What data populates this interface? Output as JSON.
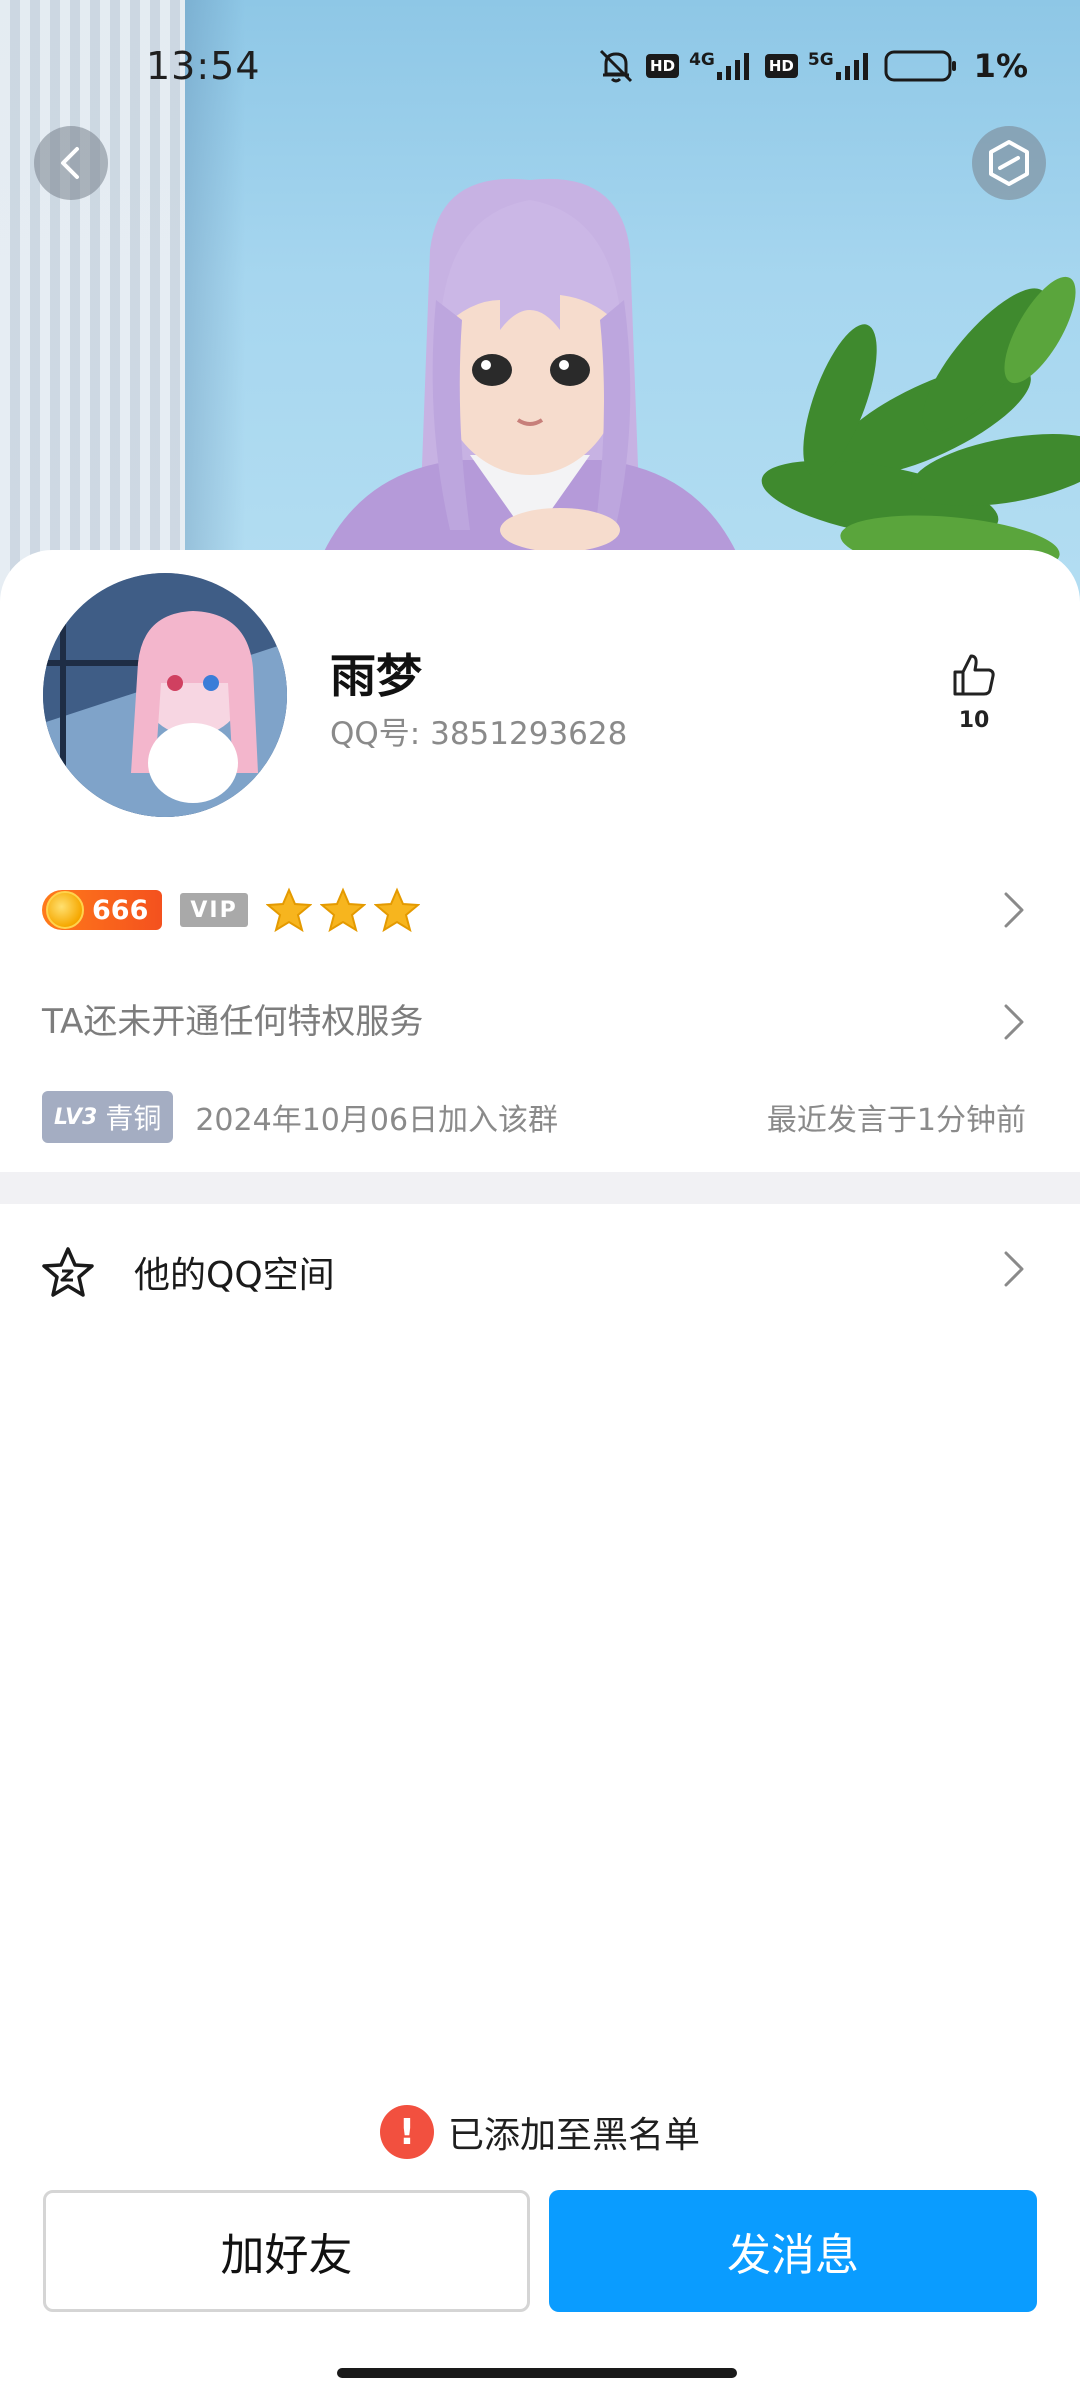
{
  "status_bar": {
    "time": "13:54",
    "hd_label": "HD",
    "net_4g": "4G",
    "net_5g": "5G",
    "battery_percent": "1%"
  },
  "header": {
    "back_icon": "back-arrow-icon",
    "share_icon": "hexagon-share-icon"
  },
  "profile": {
    "name": "雨梦",
    "qq_number": "QQ号: 3851293628",
    "like_count": "10"
  },
  "badges": {
    "coin_value": "666",
    "vip_label": "VIP",
    "star_count": 3
  },
  "service_text": "TA还未开通任何特权服务",
  "group": {
    "level_num": "LV3",
    "level_name": "青铜",
    "join_text": "2024年10月06日加入该群",
    "last_speak": "最近发言于1分钟前"
  },
  "qzone": {
    "label": "他的QQ空间"
  },
  "notice": {
    "icon_text": "!",
    "text": "已添加至黑名单"
  },
  "buttons": {
    "add_friend": "加好友",
    "send_message": "发消息"
  },
  "colors": {
    "primary_blue": "#0a9cff",
    "warning_red": "#f2503f",
    "coin_orange": "#f4511e"
  }
}
